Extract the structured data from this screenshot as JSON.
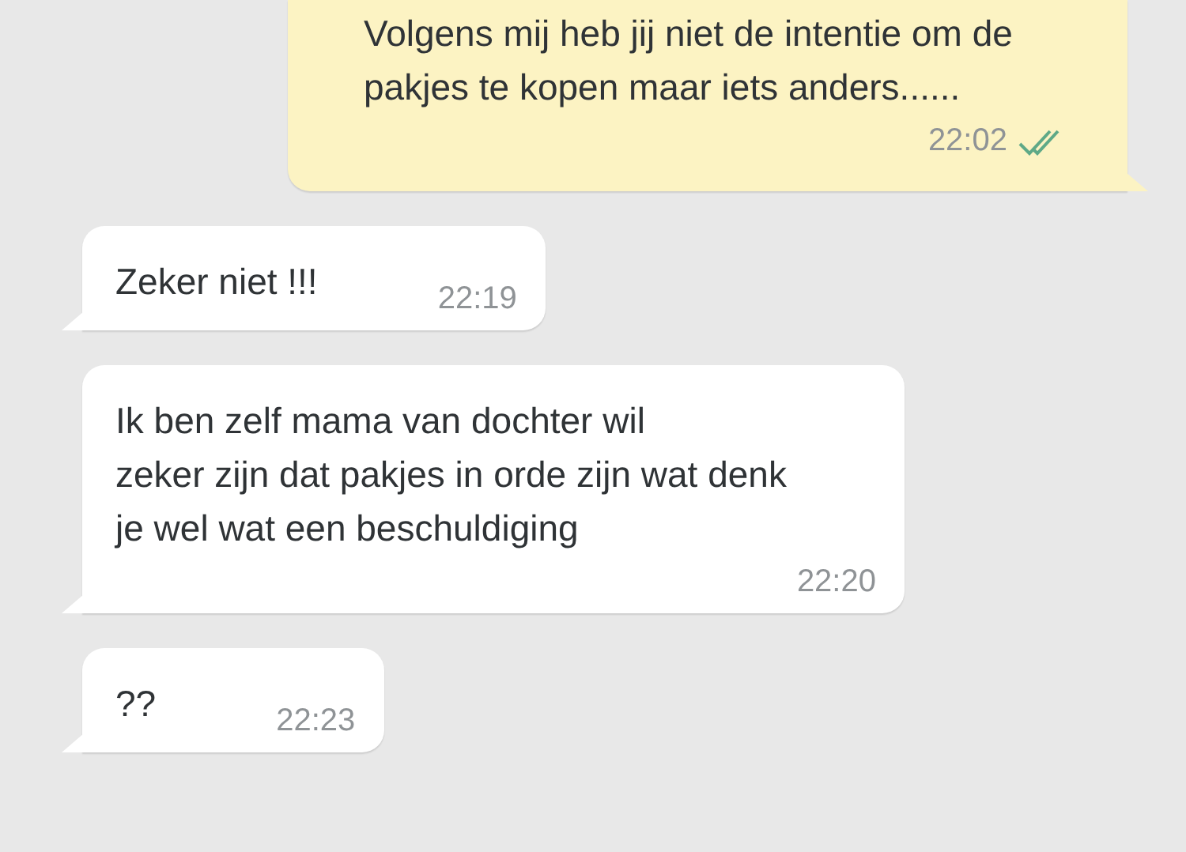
{
  "messages": [
    {
      "kind": "outgoing",
      "text": "Volgens mij heb jij niet de intentie om de pakjes te kopen maar iets anders......",
      "time": "22:02",
      "read": true
    },
    {
      "kind": "incoming",
      "text": "Zeker niet !!!",
      "time": "22:19"
    },
    {
      "kind": "incoming",
      "text": "Ik ben zelf mama van dochter wil\nzeker zijn dat pakjes in orde zijn wat denk je wel wat een beschuldiging",
      "time": "22:20"
    },
    {
      "kind": "incoming",
      "text": "??",
      "time": "22:23"
    }
  ]
}
